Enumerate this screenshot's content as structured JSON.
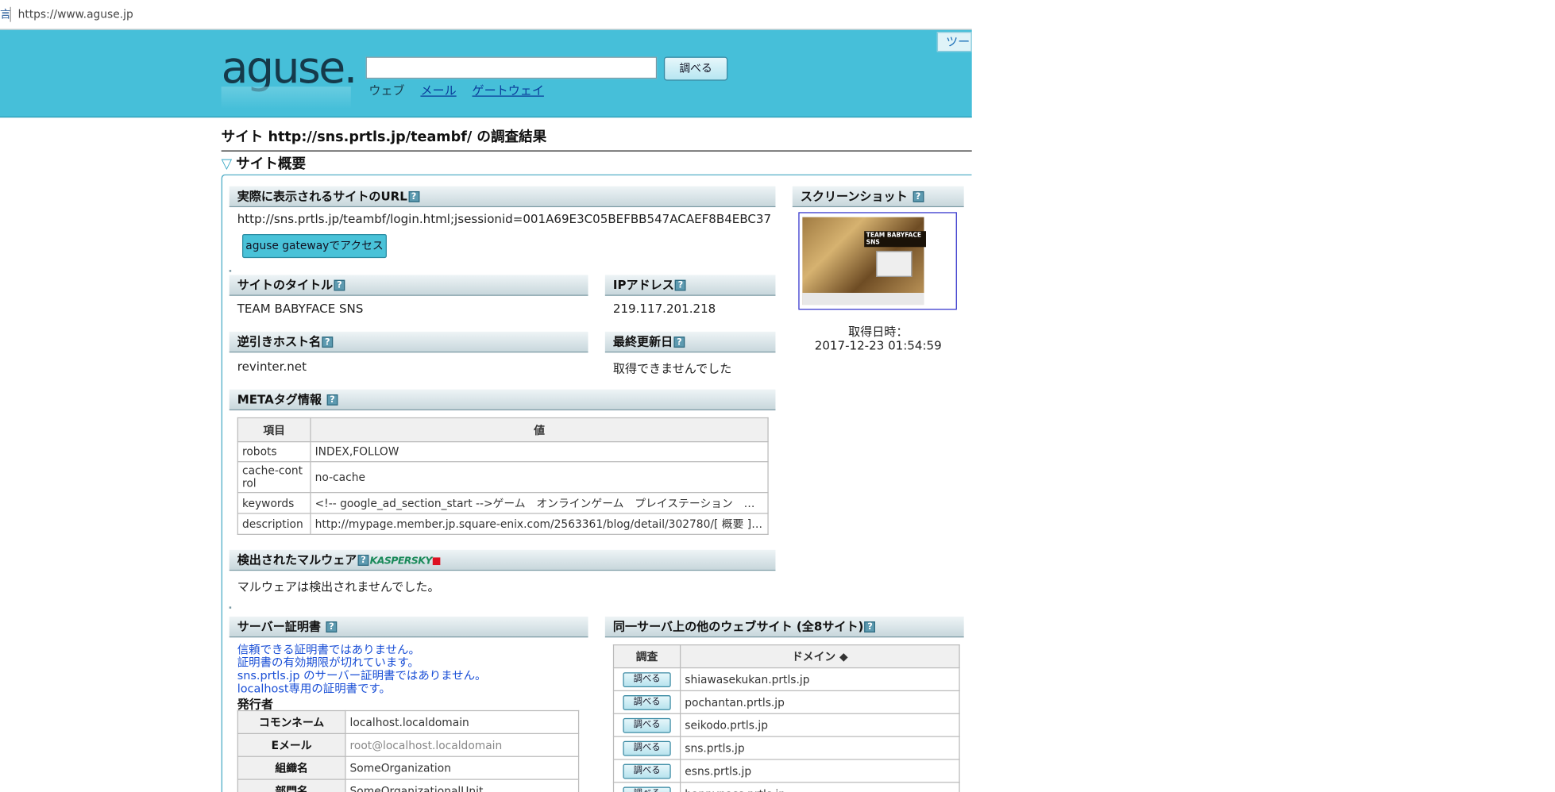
{
  "browser": {
    "edge_glyph": "言",
    "url": "https://www.aguse.jp"
  },
  "header": {
    "logo_text": "aguse.",
    "search_value": "",
    "search_button": "調べる",
    "modes": [
      "ウェブ",
      "メール",
      "ゲートウェイ"
    ],
    "tool_label": "ツー"
  },
  "result_title": "サイト http://sns.prtls.jp/teambf/ の調査結果",
  "section_title": "サイト概要",
  "help_icon": "?",
  "url_section": {
    "label": "実際に表示されるサイトのURL",
    "value": "http://sns.prtls.jp/teambf/login.html;jsessionid=001A69E3C05BEFBB547ACAEF8B4EBC37",
    "gateway_button": "aguse gatewayでアクセス"
  },
  "title_section": {
    "label": "サイトのタイトル",
    "value": "TEAM BABYFACE SNS"
  },
  "ip_section": {
    "label": "IPアドレス",
    "value": "219.117.201.218"
  },
  "rdns_section": {
    "label": "逆引きホスト名",
    "value": "revinter.net"
  },
  "updated_section": {
    "label": "最終更新日",
    "value": "取得できませんでした"
  },
  "meta_section": {
    "label": "METAタグ情報",
    "headers": [
      "項目",
      "値"
    ],
    "rows": [
      {
        "key": "robots",
        "value": "INDEX,FOLLOW"
      },
      {
        "key": "cache-control",
        "value": "no-cache"
      },
      {
        "key": "keywords",
        "value": "<!-- google_ad_section_start -->ゲーム　オンラインゲーム　プレイステーション　ニンテンドー"
      },
      {
        "key": "description",
        "value": "http://mypage.member.jp.square-enix.com/2563361/blog/detail/302780/[ 概要 ]　・主目的"
      }
    ]
  },
  "malware_section": {
    "label": "検出されたマルウェア",
    "vendor": "KASPERSKY",
    "value": "マルウェアは検出されませんでした。"
  },
  "screenshot_section": {
    "label": "スクリーンショット",
    "thumb_title": "TEAM BABYFACE SNS",
    "caption_label": "取得日時：",
    "caption_value": "2017-12-23 01:54:59"
  },
  "cert_section": {
    "label": "サーバー証明書",
    "messages": [
      "信頼できる証明書ではありません。",
      "証明書の有効期限が切れています。",
      "sns.prtls.jp のサーバー証明書ではありません。",
      "localhost専用の証明書です。"
    ],
    "issuer_label": "発行者",
    "rows": [
      {
        "key": "コモンネーム",
        "value": "localhost.localdomain"
      },
      {
        "key": "Eメール",
        "value": "root@localhost.localdomain"
      },
      {
        "key": "組織名",
        "value": "SomeOrganization"
      },
      {
        "key": "部門名",
        "value": "SomeOrganizationalUnit"
      }
    ]
  },
  "sites_section": {
    "label": "同一サーバ上の他のウェブサイト (全8サイト)",
    "headers": [
      "調査",
      "ドメイン ◆"
    ],
    "button": "調べる",
    "domains": [
      "shiawasekukan.prtls.jp",
      "pochantan.prtls.jp",
      "seikodo.prtls.jp",
      "sns.prtls.jp",
      "esns.prtls.jp",
      "happypass.prtls.jp"
    ]
  },
  "colors": {
    "header_bg": "#46bfd9",
    "link": "#1a4fd6",
    "border": "#3aa3bf"
  }
}
